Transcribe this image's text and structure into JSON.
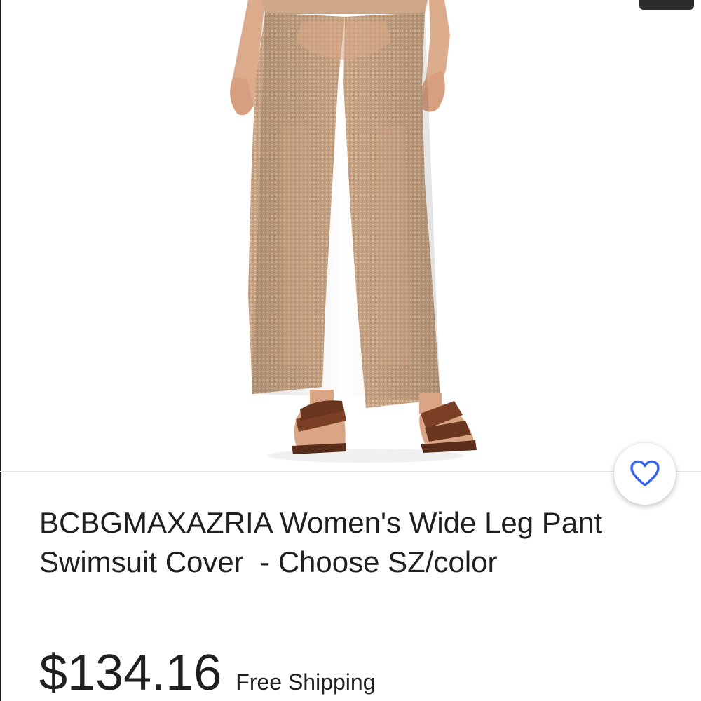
{
  "listing": {
    "title": "BCBGMAXAZRIA Women's Wide Leg Pant Swimsuit Cover  - Choose SZ/color",
    "price": "$134.16",
    "shipping": "Free Shipping"
  },
  "image": {
    "subject": "product-photo"
  },
  "actions": {
    "watch_icon": "heart-icon"
  },
  "colors": {
    "accent": "#3665f3",
    "text": "#1f1f1f",
    "fabric": "#c4a07e",
    "sandal": "#7a3f24",
    "skin": "#d9a585"
  }
}
